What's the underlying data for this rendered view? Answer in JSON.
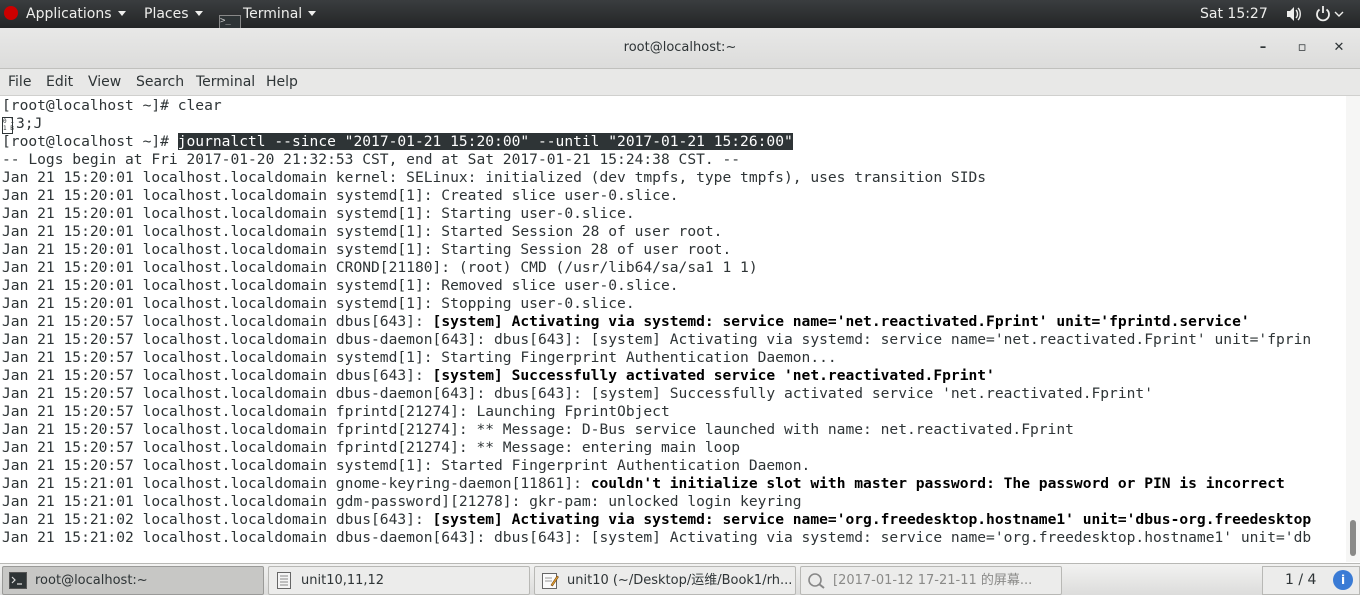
{
  "topbar": {
    "applications": "Applications",
    "places": "Places",
    "terminal": "Terminal",
    "clock": "Sat 15:27"
  },
  "window": {
    "title": "root@localhost:~",
    "minimize": "–",
    "maximize": "▫",
    "close": "✕"
  },
  "menu": [
    "File",
    "Edit",
    "View",
    "Search",
    "Terminal",
    "Help"
  ],
  "terminal": {
    "lines": [
      {
        "plain": "[root@localhost ~]# clear"
      },
      {
        "glyph": "0 1\n1 B",
        "plain": "3;J"
      },
      {
        "plain": "[root@localhost ~]# ",
        "selected": "journalctl --since \"2017-01-21 15:20:00\" --until \"2017-01-21 15:26:00\""
      },
      {
        "plain": "-- Logs begin at Fri 2017-01-20 21:32:53 CST, end at Sat 2017-01-21 15:24:38 CST. --"
      },
      {
        "plain": "Jan 21 15:20:01 localhost.localdomain kernel: SELinux: initialized (dev tmpfs, type tmpfs), uses transition SIDs"
      },
      {
        "plain": "Jan 21 15:20:01 localhost.localdomain systemd[1]: Created slice user-0.slice."
      },
      {
        "plain": "Jan 21 15:20:01 localhost.localdomain systemd[1]: Starting user-0.slice."
      },
      {
        "plain": "Jan 21 15:20:01 localhost.localdomain systemd[1]: Started Session 28 of user root."
      },
      {
        "plain": "Jan 21 15:20:01 localhost.localdomain systemd[1]: Starting Session 28 of user root."
      },
      {
        "plain": "Jan 21 15:20:01 localhost.localdomain CROND[21180]: (root) CMD (/usr/lib64/sa/sa1 1 1)"
      },
      {
        "plain": "Jan 21 15:20:01 localhost.localdomain systemd[1]: Removed slice user-0.slice."
      },
      {
        "plain": "Jan 21 15:20:01 localhost.localdomain systemd[1]: Stopping user-0.slice."
      },
      {
        "plain": "Jan 21 15:20:57 localhost.localdomain dbus[643]: ",
        "bold": "[system] Activating via systemd: service name='net.reactivated.Fprint' unit='fprintd.service'"
      },
      {
        "plain": "Jan 21 15:20:57 localhost.localdomain dbus-daemon[643]: dbus[643]: [system] Activating via systemd: service name='net.reactivated.Fprint' unit='fprin"
      },
      {
        "plain": "Jan 21 15:20:57 localhost.localdomain systemd[1]: Starting Fingerprint Authentication Daemon..."
      },
      {
        "plain": "Jan 21 15:20:57 localhost.localdomain dbus[643]: ",
        "bold": "[system] Successfully activated service 'net.reactivated.Fprint'"
      },
      {
        "plain": "Jan 21 15:20:57 localhost.localdomain dbus-daemon[643]: dbus[643]: [system] Successfully activated service 'net.reactivated.Fprint'"
      },
      {
        "plain": "Jan 21 15:20:57 localhost.localdomain fprintd[21274]: Launching FprintObject"
      },
      {
        "plain": "Jan 21 15:20:57 localhost.localdomain fprintd[21274]: ** Message: D-Bus service launched with name: net.reactivated.Fprint"
      },
      {
        "plain": "Jan 21 15:20:57 localhost.localdomain fprintd[21274]: ** Message: entering main loop"
      },
      {
        "plain": "Jan 21 15:20:57 localhost.localdomain systemd[1]: Started Fingerprint Authentication Daemon."
      },
      {
        "plain": "Jan 21 15:21:01 localhost.localdomain gnome-keyring-daemon[11861]: ",
        "bold": "couldn't initialize slot with master password: The password or PIN is incorrect"
      },
      {
        "plain": "Jan 21 15:21:01 localhost.localdomain gdm-password][21278]: gkr-pam: unlocked login keyring"
      },
      {
        "plain": "Jan 21 15:21:02 localhost.localdomain dbus[643]: ",
        "bold": "[system] Activating via systemd: service name='org.freedesktop.hostname1' unit='dbus-org.freedesktop"
      },
      {
        "plain": "Jan 21 15:21:02 localhost.localdomain dbus-daemon[643]: dbus[643]: [system] Activating via systemd: service name='org.freedesktop.hostname1' unit='db"
      }
    ]
  },
  "taskbar": {
    "tasks": [
      {
        "label": "root@localhost:~",
        "icon": "terminal-icon"
      },
      {
        "label": "unit10,11,12",
        "icon": "file-manager-icon"
      },
      {
        "label": "unit10 (~/Desktop/运维/Book1/rh...",
        "icon": "text-editor-icon"
      },
      {
        "label": "[2017-01-12 17-21-11 的屏幕...",
        "icon": "image-viewer-icon"
      }
    ],
    "pager": "1 / 4",
    "info": "i"
  }
}
